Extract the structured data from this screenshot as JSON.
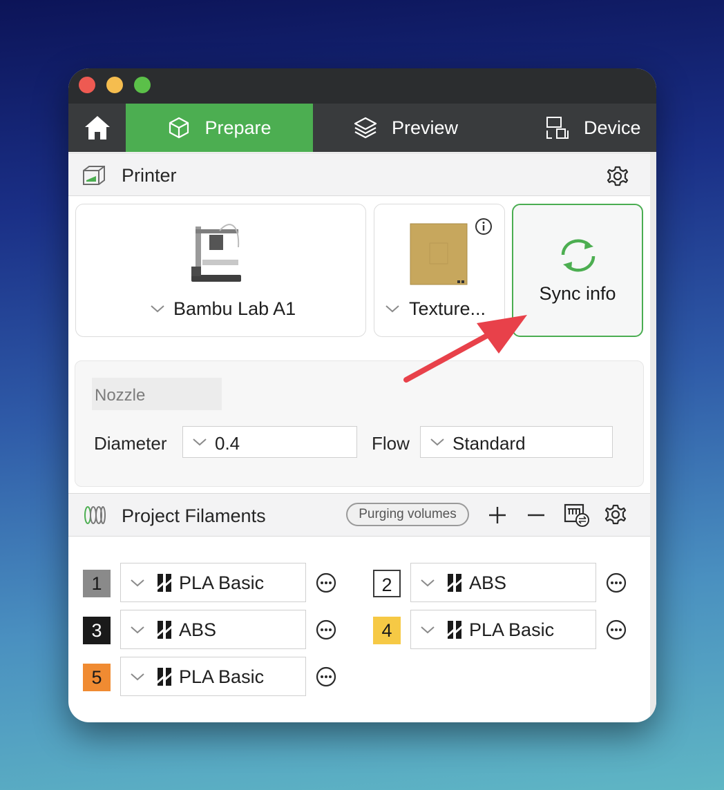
{
  "tabs": {
    "home_icon": "house-icon",
    "prepare": "Prepare",
    "preview": "Preview",
    "device": "Device"
  },
  "printer_section": {
    "title": "Printer",
    "printer_model": "Bambu Lab A1",
    "plate": "Texture...",
    "sync_label": "Sync info",
    "nozzle": {
      "heading": "Nozzle",
      "diameter_label": "Diameter",
      "diameter_value": "0.4",
      "flow_label": "Flow",
      "flow_value": "Standard"
    }
  },
  "filaments_section": {
    "title": "Project Filaments",
    "purging_label": "Purging volumes",
    "items": [
      {
        "num": "1",
        "name": "PLA Basic",
        "color": "#8a8a8a"
      },
      {
        "num": "2",
        "name": "ABS",
        "color": "#ffffff"
      },
      {
        "num": "3",
        "name": "ABS",
        "color": "#1a1a1a"
      },
      {
        "num": "4",
        "name": "PLA Basic",
        "color": "#f6c945"
      },
      {
        "num": "5",
        "name": "PLA Basic",
        "color": "#f08b32"
      }
    ]
  },
  "colors": {
    "accent": "#4cae51",
    "annotation_arrow": "#e8414a"
  }
}
